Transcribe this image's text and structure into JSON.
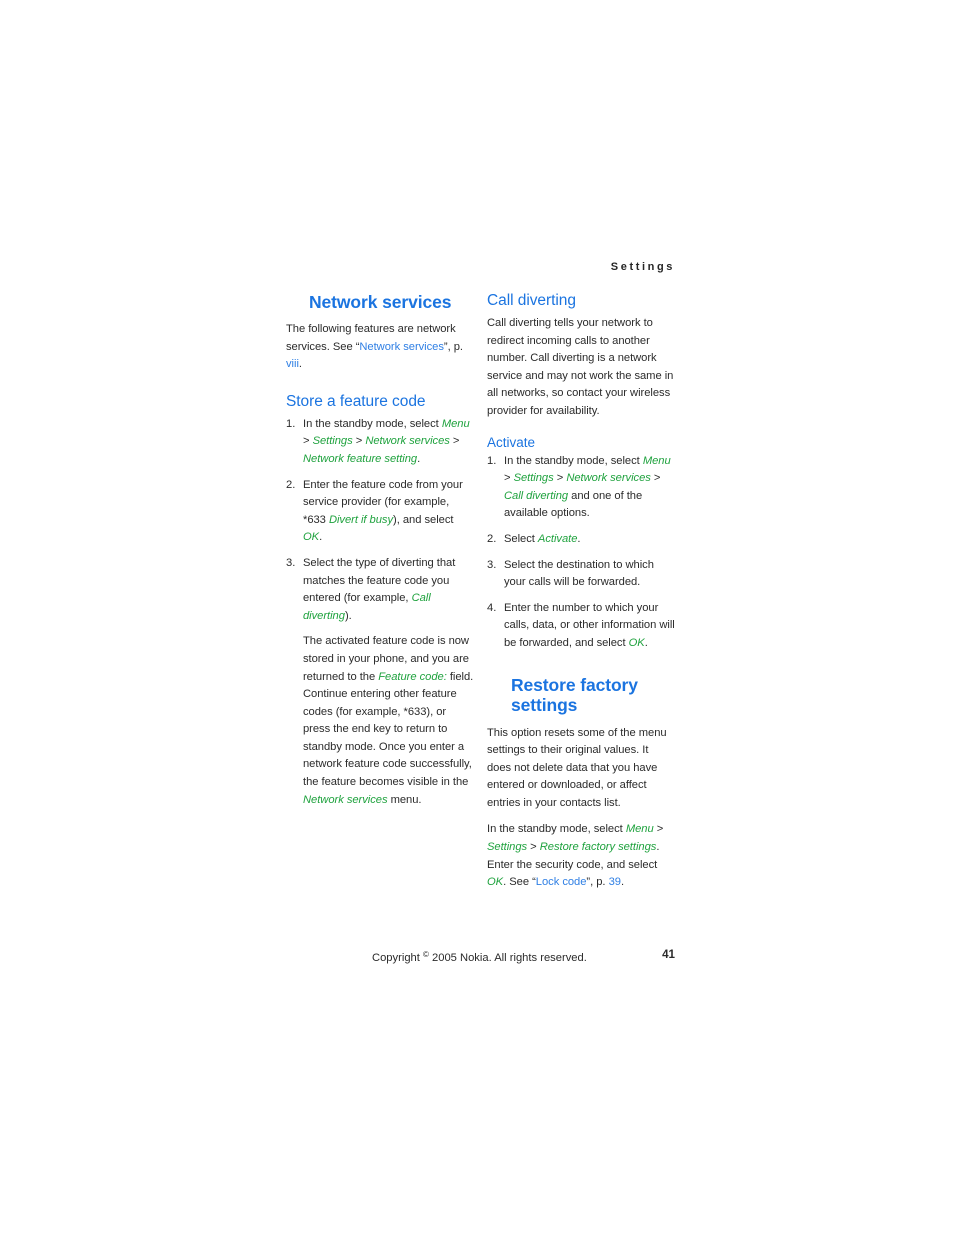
{
  "header": {
    "running_head": "Settings"
  },
  "left_column": {
    "chapter_title": "Network services",
    "intro": {
      "before_link": "The following features are network services. See “",
      "link": "Network services",
      "after_link": "”, p. ",
      "page_ref": "viii",
      "tail": "."
    },
    "store_section": {
      "title": "Store a feature code",
      "step1": {
        "t1": "In the standby mode, select ",
        "ui1": "Menu",
        "s1": " > ",
        "ui2": "Settings",
        "s2": " > ",
        "ui3": "Network services",
        "s3": " > ",
        "ui4": "Network feature setting",
        "t2": "."
      },
      "step2": {
        "t1": "Enter the feature code from your service provider (for example, *633 ",
        "ui1": "Divert if busy",
        "t2": "), and select ",
        "ui2": "OK",
        "t3": "."
      },
      "step3": {
        "t1": "Select the type of diverting that matches the feature code you entered (for example, ",
        "ui1": "Call diverting",
        "t2": ").",
        "continuation": {
          "c1": "The activated feature code is now stored in your phone, and you are returned to the ",
          "ui1": "Feature code:",
          "c2": " field. Continue entering other feature codes (for example, *633), or press the end key to return to standby mode. Once you enter a network feature code successfully, the feature becomes visible in the ",
          "ui2": "Network services",
          "c3": " menu."
        }
      }
    }
  },
  "right_column": {
    "call_diverting": {
      "title": "Call diverting",
      "body": "Call diverting tells your network to redirect incoming calls to another number. Call diverting is a network service and may not work the same in all networks, so contact your wireless provider for availability."
    },
    "activate": {
      "title": "Activate",
      "step1": {
        "t1": "In the standby mode, select ",
        "ui1": "Menu",
        "s1": " > ",
        "ui2": "Settings",
        "s2": " > ",
        "ui3": "Network services",
        "s3": " > ",
        "ui4": "Call diverting",
        "t2": " and one of the available options."
      },
      "step2": {
        "t1": "Select ",
        "ui1": "Activate",
        "t2": "."
      },
      "step3": {
        "t1": "Select the destination to which your calls will be forwarded."
      },
      "step4": {
        "t1": "Enter the number to which your calls, data, or other information will be forwarded, and select ",
        "ui1": "OK",
        "t2": "."
      }
    },
    "restore": {
      "chapter_title_line1": "Restore factory",
      "chapter_title_line2": "settings",
      "body": "This option resets some of the menu settings to their original values. It does not delete data that you have entered or downloaded, or affect entries in your contacts list.",
      "procedure": {
        "t1": "In the standby mode, select ",
        "ui1": "Menu",
        "s1": " > ",
        "ui2": "Settings",
        "s2": " > ",
        "ui3": "Restore factory settings",
        "t2": ". Enter the security code, and select ",
        "ui4": "OK",
        "t3": ". See “",
        "link": "Lock code",
        "t4": "”, p. ",
        "page_ref": "39",
        "t5": "."
      }
    }
  },
  "footer": {
    "copyright_before": "Copyright ",
    "copyright_symbol": "©",
    "copyright_after": " 2005 Nokia. All rights reserved.",
    "page_number": "41"
  },
  "colors": {
    "heading_blue": "#1b74e0",
    "link_blue": "#2f7fe4",
    "ui_green": "#1fa23e",
    "body_text": "#2b2b2b",
    "page_background": "#ffffff"
  }
}
